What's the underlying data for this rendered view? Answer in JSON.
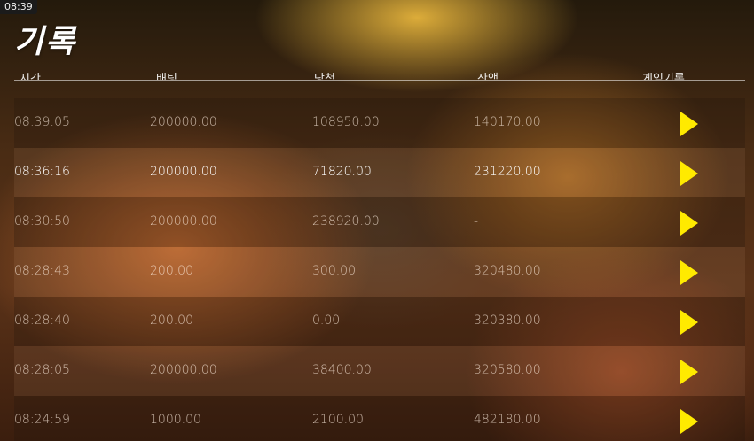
{
  "status": {
    "time": "08:39"
  },
  "page": {
    "title": "기록"
  },
  "columns": [
    "시간",
    "배팅",
    "당첨",
    "잔액",
    "게임기록"
  ],
  "rows": [
    {
      "time": "08:39:05",
      "bet": "200000.00",
      "win": "108950.00",
      "balance": "140170.00"
    },
    {
      "time": "08:36:16",
      "bet": "200000.00",
      "win": "71820.00",
      "balance": "231220.00"
    },
    {
      "time": "08:30:50",
      "bet": "200000.00",
      "win": "238920.00",
      "balance": "-"
    },
    {
      "time": "08:28:43",
      "bet": "200.00",
      "win": "300.00",
      "balance": "320480.00"
    },
    {
      "time": "08:28:40",
      "bet": "200.00",
      "win": "0.00",
      "balance": "320380.00"
    },
    {
      "time": "08:28:05",
      "bet": "200000.00",
      "win": "38400.00",
      "balance": "320580.00"
    },
    {
      "time": "08:24:59",
      "bet": "1000.00",
      "win": "2100.00",
      "balance": "482180.00"
    }
  ],
  "colors": {
    "play": "#ffea00"
  },
  "icons": {
    "replay": "play-icon"
  }
}
